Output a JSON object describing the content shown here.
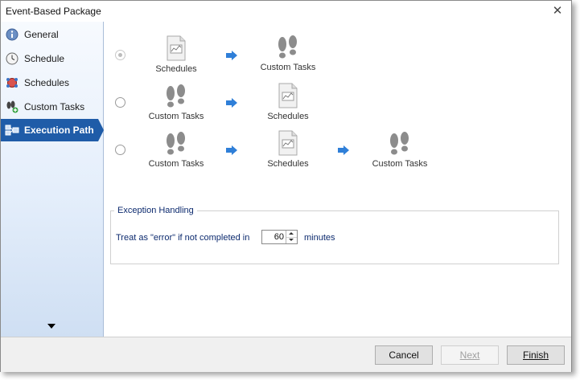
{
  "window": {
    "title": "Event-Based Package",
    "close_glyph": "✕"
  },
  "sidebar": {
    "items": [
      {
        "label": "General",
        "icon": "info-icon",
        "active": false
      },
      {
        "label": "Schedule",
        "icon": "clock-icon",
        "active": false
      },
      {
        "label": "Schedules",
        "icon": "schedules-icon",
        "active": false
      },
      {
        "label": "Custom Tasks",
        "icon": "footsteps-add-icon",
        "active": false
      },
      {
        "label": "Execution Path",
        "icon": "flow-icon",
        "active": true
      }
    ]
  },
  "execution_paths": [
    {
      "selected": true,
      "steps": [
        "Schedules",
        "Custom Tasks"
      ]
    },
    {
      "selected": false,
      "steps": [
        "Custom Tasks",
        "Schedules"
      ]
    },
    {
      "selected": false,
      "steps": [
        "Custom Tasks",
        "Schedules",
        "Custom Tasks"
      ]
    }
  ],
  "exception_handling": {
    "legend": "Exception Handling",
    "treat_label": "Treat as \"error\" if not completed in",
    "minutes_value": "60",
    "minutes_label": "minutes"
  },
  "footer": {
    "cancel_label": "Cancel",
    "next_label": "Next",
    "next_enabled": false,
    "finish_label": "Finish"
  },
  "colors": {
    "active_nav": "#1f5ca8",
    "arrow": "#2f7fd8",
    "group_text": "#0c2a6e"
  }
}
